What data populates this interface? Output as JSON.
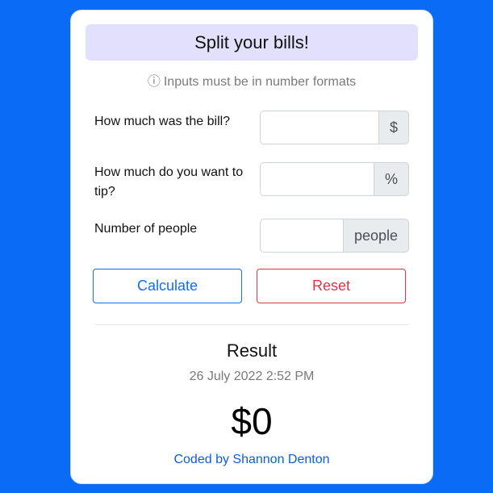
{
  "header": {
    "title": "Split your bills!"
  },
  "hint": {
    "icon": "info-icon",
    "icon_glyph": "ⓘ",
    "text": "Inputs must be in number formats"
  },
  "fields": {
    "bill": {
      "label": "How much was the bill?",
      "value": "",
      "addon": "$"
    },
    "tip": {
      "label": "How much do you want to tip?",
      "value": "",
      "addon": "%"
    },
    "people": {
      "label": "Number of people",
      "value": "",
      "addon": "people"
    }
  },
  "buttons": {
    "calculate": "Calculate",
    "reset": "Reset"
  },
  "result": {
    "heading": "Result",
    "timestamp": "26 July 2022 2:52 PM",
    "amount": "$0"
  },
  "footer": {
    "credit": "Coded by Shannon Denton"
  },
  "colors": {
    "background": "#0a6cf5",
    "title_bar": "#e2e0fb",
    "calculate": "#0d6efd",
    "reset": "#dc3545",
    "credit": "#0b5ed7"
  }
}
